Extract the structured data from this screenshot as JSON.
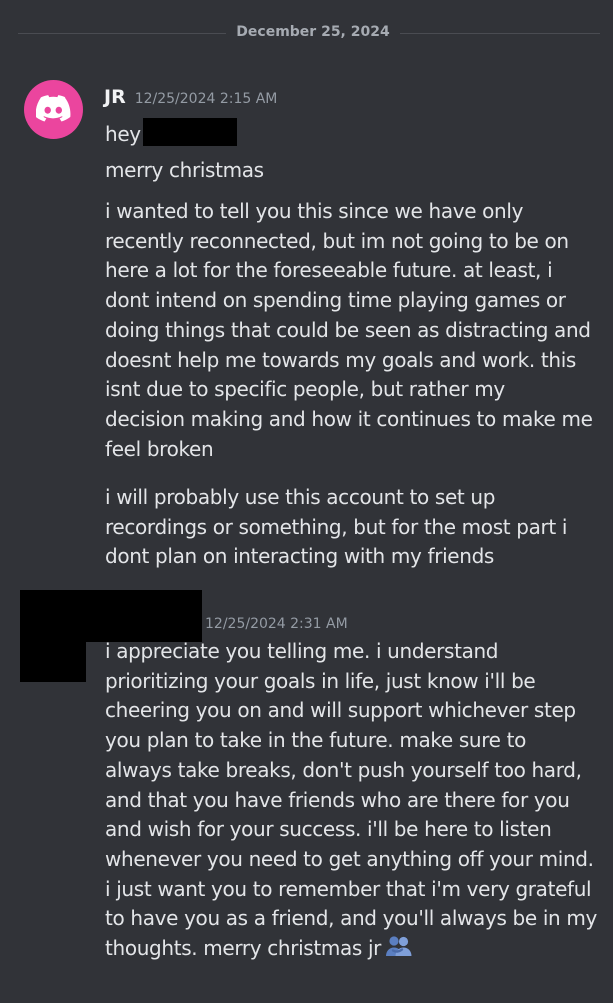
{
  "divider": {
    "date": "December 25, 2024"
  },
  "messages": [
    {
      "author": "JR",
      "timestamp": "12/25/2024 2:15 AM",
      "lines": [
        "hey",
        "merry christmas"
      ],
      "paragraph2": [
        "i wanted to tell you this since we have only",
        "recently reconnected, but im not going to be on",
        "here a lot for the foreseeable future. at least, i",
        "dont intend on spending time playing games or",
        "doing things that could be seen as distracting and",
        "doesnt help me towards my goals and work. this",
        "isnt due to specific people, but rather my",
        "decision making and how it continues to make me",
        "feel broken"
      ],
      "paragraph3": [
        "i will probably use this account to set up",
        "recordings or something, but for the most part i",
        "dont plan on interacting with my friends"
      ]
    },
    {
      "author": "",
      "timestamp": "12/25/2024 2:31 AM",
      "lines": [
        "i appreciate you telling me. i understand",
        "prioritizing your goals in life, just know i'll be",
        "cheering you on and will support whichever step",
        "you plan to take in the future. make sure to",
        "always take breaks, don't push yourself too hard,",
        "and that you have friends who are there for you",
        "and wish for your success. i'll be here to listen",
        "whenever you need to get anything off your mind.",
        "i just want you to remember that i'm very grateful",
        "to have you as a friend, and you'll always be in my",
        "thoughts. merry christmas jr"
      ],
      "emoji": "people-hugging"
    }
  ]
}
